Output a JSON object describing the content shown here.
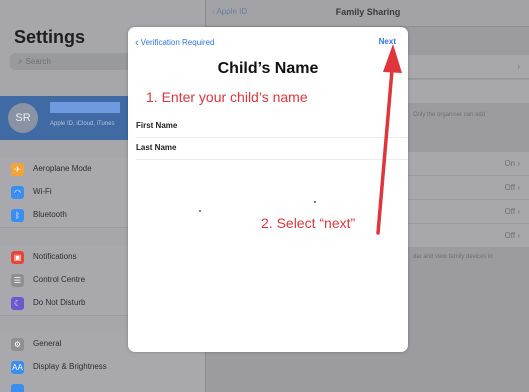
{
  "colors": {
    "accent": "#2f76e8",
    "annotation": "#e0353b",
    "account_highlight": "#3f6aa3"
  },
  "sidebar": {
    "title": "Settings",
    "search_placeholder": "Search",
    "account": {
      "initials": "SR",
      "subtitle": "Apple ID, iCloud, iTunes"
    },
    "items": [
      {
        "label": "Aeroplane Mode",
        "icon": "airplane-icon",
        "color": "#f2a33a"
      },
      {
        "label": "Wi-Fi",
        "icon": "wifi-icon",
        "color": "#3b8ef0"
      },
      {
        "label": "Bluetooth",
        "icon": "bluetooth-icon",
        "color": "#3b8ef0"
      },
      {
        "label": "Notifications",
        "icon": "notifications-icon",
        "color": "#e8443a"
      },
      {
        "label": "Control Centre",
        "icon": "control-centre-icon",
        "color": "#8e8e93"
      },
      {
        "label": "Do Not Disturb",
        "icon": "moon-icon",
        "color": "#6a5acd"
      },
      {
        "label": "General",
        "icon": "gear-icon",
        "color": "#8e8e93"
      },
      {
        "label": "Display & Brightness",
        "icon": "display-icon",
        "color": "#3b8ef0"
      }
    ]
  },
  "detail": {
    "back_label": "Apple ID",
    "title": "Family Sharing",
    "organiser_note": "Only the organiser can add",
    "sharing_values": [
      "On",
      "Off",
      "Off",
      "Off"
    ],
    "family_note": "dar and view family devices in"
  },
  "modal": {
    "back_label": "Verification Required",
    "next_label": "Next",
    "title": "Child’s Name",
    "first_name_label": "First Name",
    "last_name_label": "Last Name"
  },
  "annotations": {
    "step1": "1. Enter your child’s name",
    "step2": "2. Select “next”"
  }
}
